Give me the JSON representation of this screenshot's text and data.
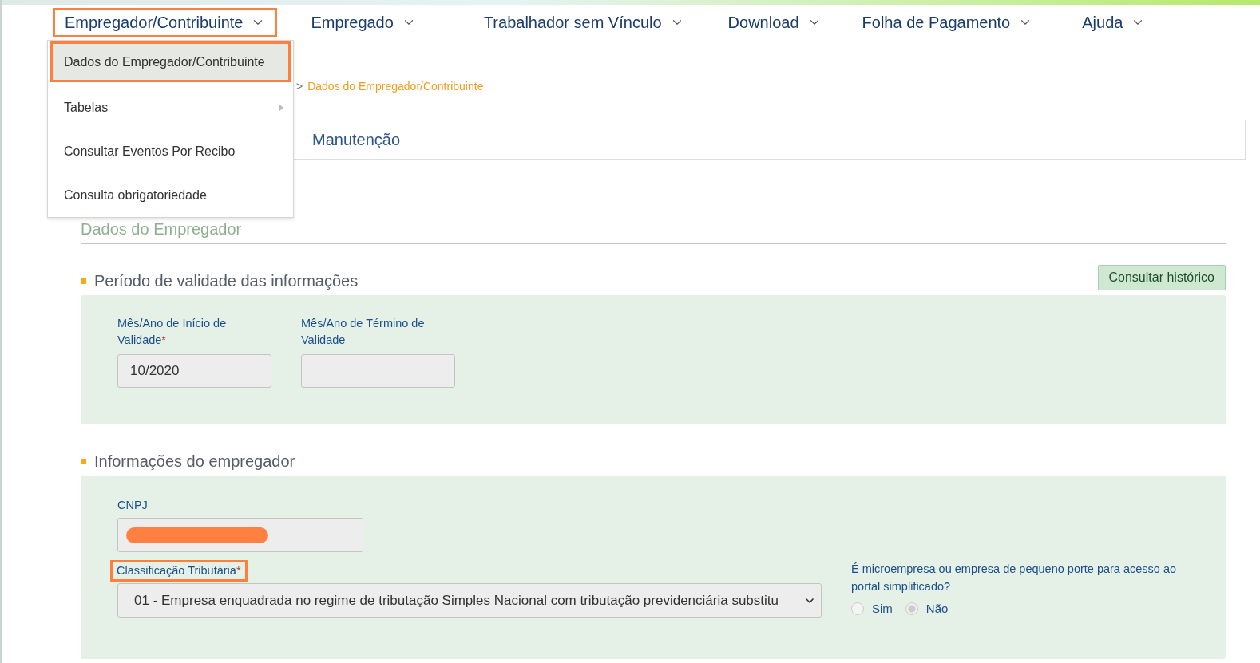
{
  "nav": [
    {
      "label": "Empregador/Contribuinte",
      "highlighted": true
    },
    {
      "label": "Empregado",
      "highlighted": false
    },
    {
      "label": "Trabalhador sem Vínculo",
      "highlighted": false
    },
    {
      "label": "Download",
      "highlighted": false
    },
    {
      "label": "Folha de Pagamento",
      "highlighted": false
    },
    {
      "label": "Ajuda",
      "highlighted": false
    }
  ],
  "dropdown": [
    {
      "label": "Dados do Empregador/Contribuinte",
      "selected": true,
      "highlighted": true,
      "has_submenu": false
    },
    {
      "label": "Tabelas",
      "selected": false,
      "highlighted": false,
      "has_submenu": true
    },
    {
      "label": "Consultar Eventos Por Recibo",
      "selected": false,
      "highlighted": false,
      "has_submenu": false
    },
    {
      "label": "Consulta obrigatoriedade",
      "selected": false,
      "highlighted": false,
      "has_submenu": false
    }
  ],
  "breadcrumb": {
    "separator": ">",
    "current": "Dados do Empregador/Contribuinte"
  },
  "tabs": [
    {
      "label": "Manutenção",
      "selected": false
    }
  ],
  "card_title": "Dados do Empregador",
  "history_button": "Consultar histórico",
  "sections": [
    {
      "title": "Período de validade das informações",
      "kind": "period",
      "fields": [
        {
          "label": "Mês/Ano de Início de Validade",
          "required_mark": "*",
          "value": "10/2020"
        },
        {
          "label": "Mês/Ano de Término de Validade"
        }
      ]
    },
    {
      "title": "Informações do empregador",
      "kind": "employer",
      "cnpj": {
        "label": "CNPJ",
        "redacted": true
      },
      "classification": {
        "label": "Classificação Tributária",
        "required_mark": "*",
        "highlighted": true,
        "value": "01 - Empresa enquadrada no regime de tributação Simples Nacional com tributação previdenciária substitu"
      },
      "question": {
        "label": "É microempresa ou empresa de pequeno porte para acesso ao portal simplificado?",
        "options": [
          {
            "label": "Sim",
            "selected": false
          },
          {
            "label": "Não",
            "selected": true
          }
        ]
      }
    }
  ]
}
